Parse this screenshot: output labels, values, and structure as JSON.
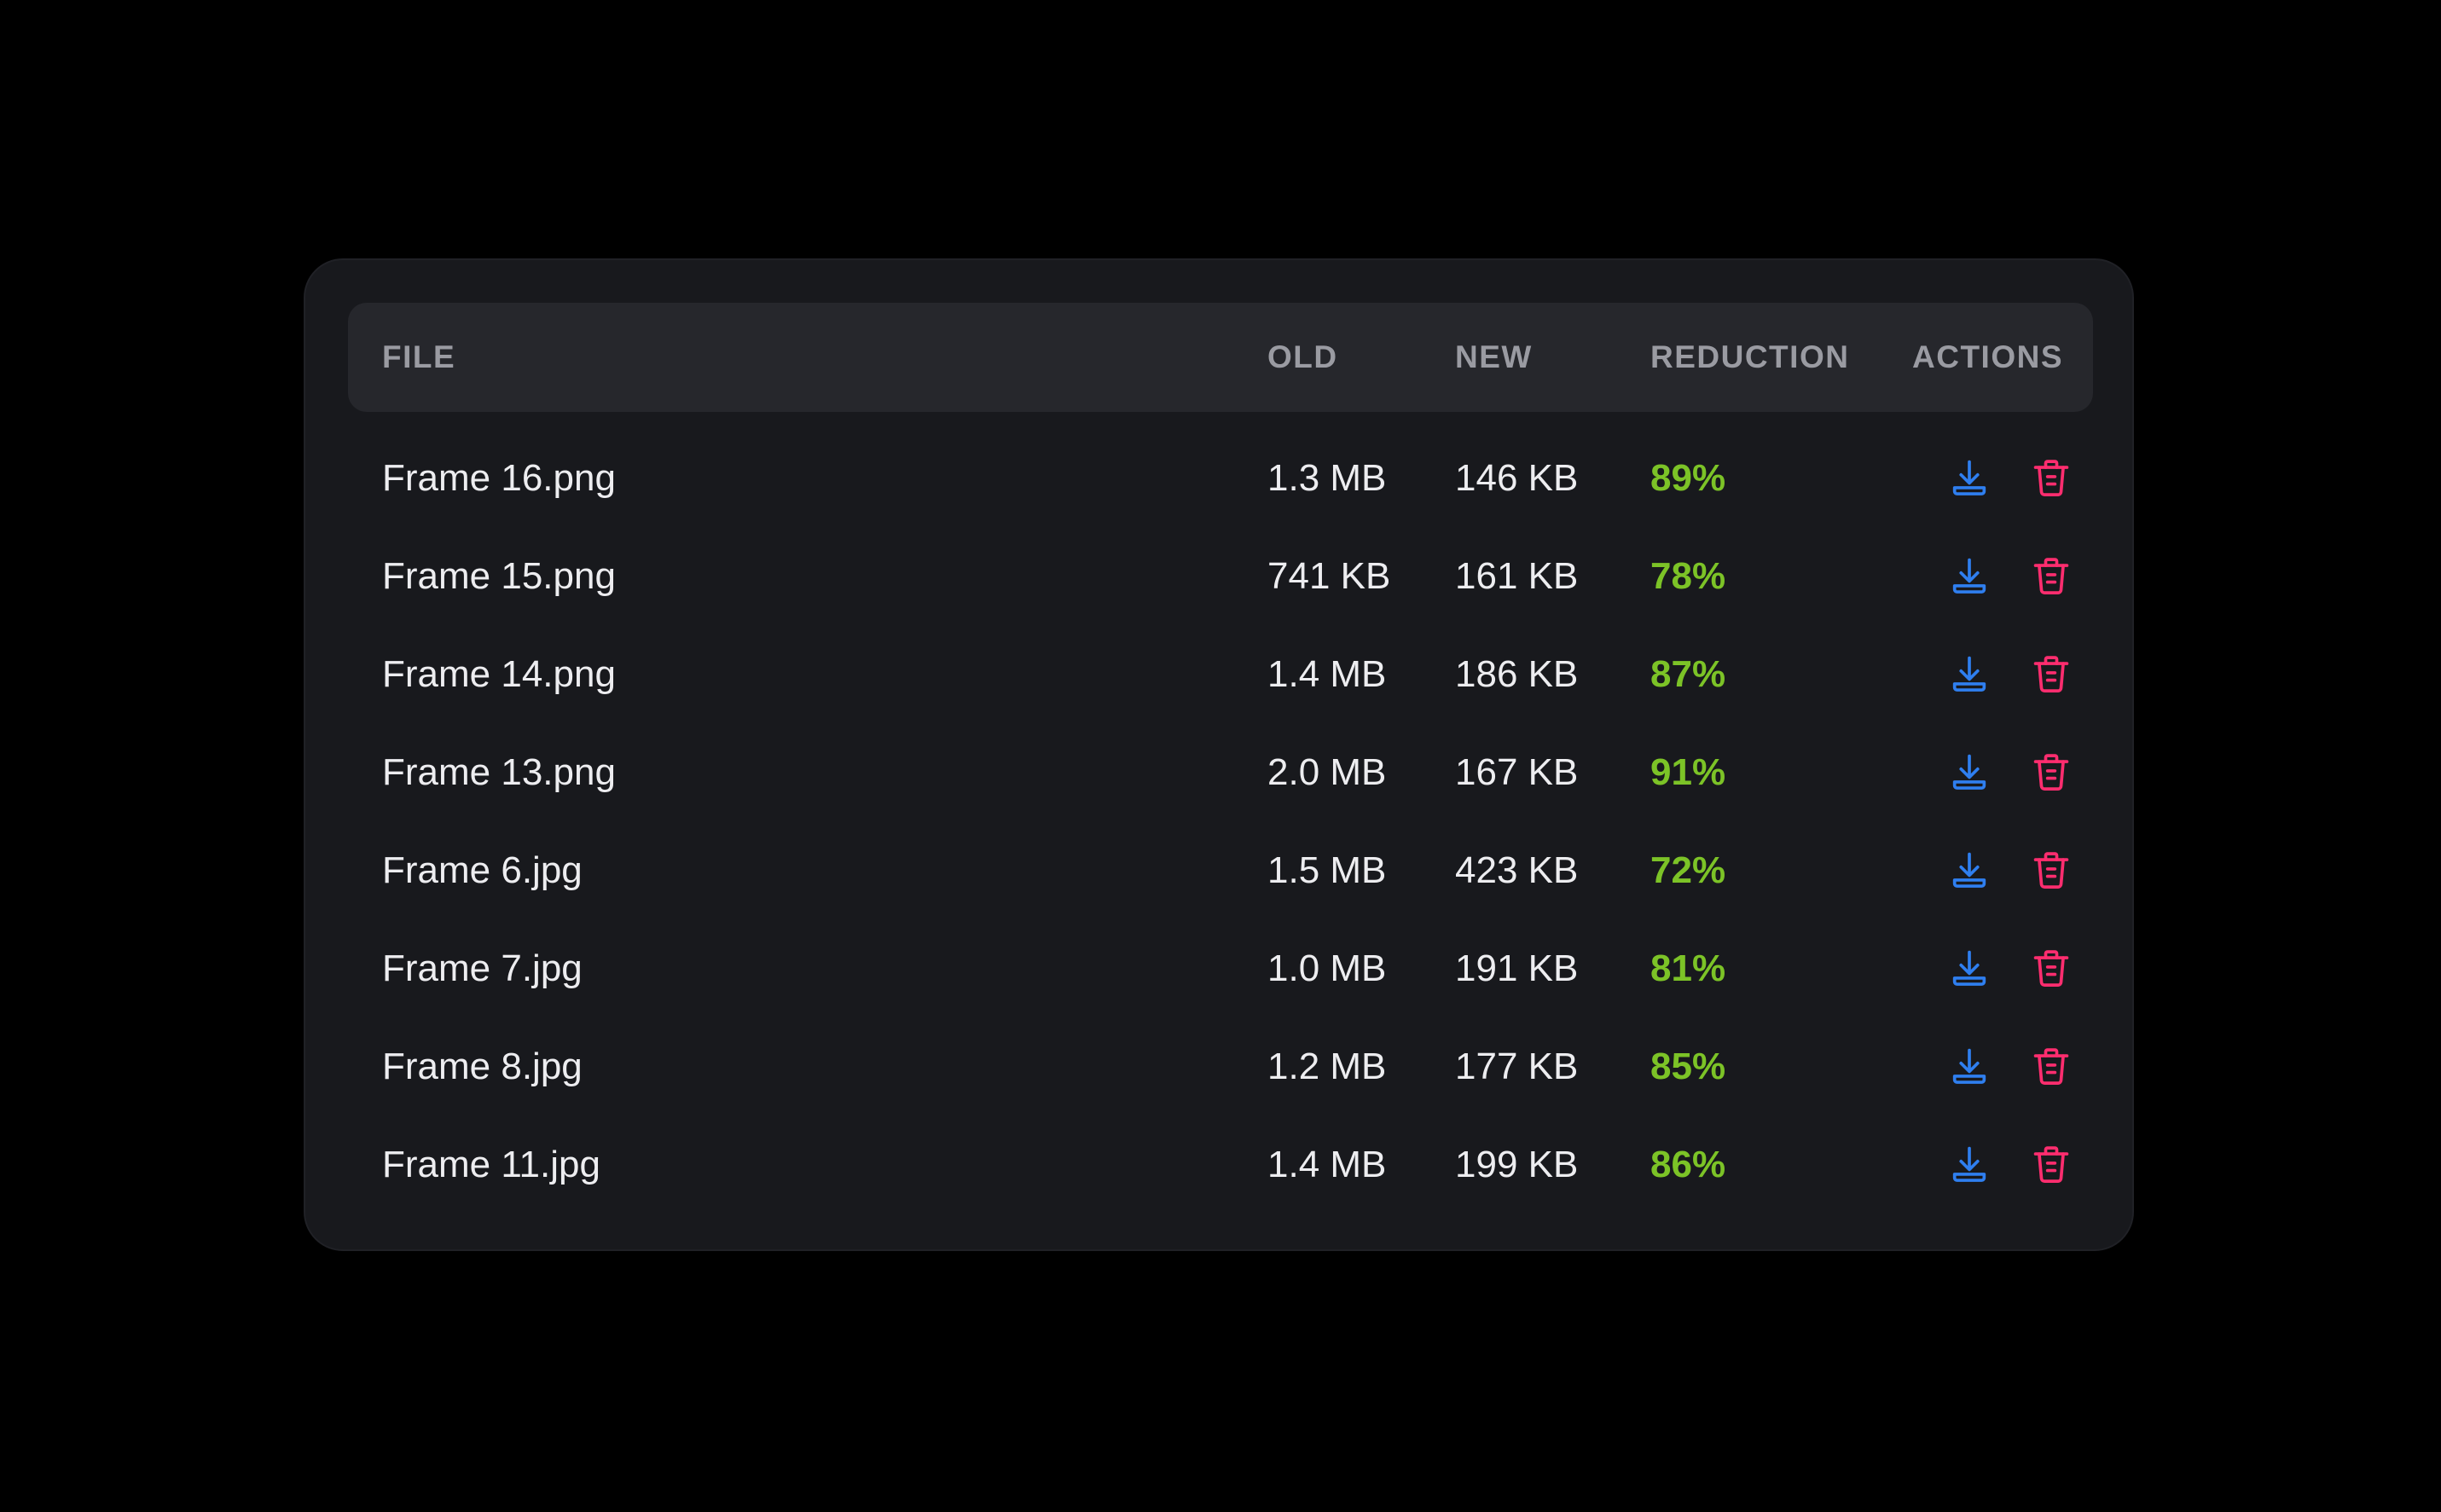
{
  "table": {
    "columns": {
      "file": "FILE",
      "old": "OLD",
      "new": "NEW",
      "reduction": "REDUCTION",
      "actions": "ACTIONS"
    },
    "rows": [
      {
        "file": "Frame 16.png",
        "old": "1.3 MB",
        "new": "146 KB",
        "reduction": "89%"
      },
      {
        "file": "Frame 15.png",
        "old": "741 KB",
        "new": "161 KB",
        "reduction": "78%"
      },
      {
        "file": "Frame 14.png",
        "old": "1.4 MB",
        "new": "186 KB",
        "reduction": "87%"
      },
      {
        "file": "Frame 13.png",
        "old": "2.0 MB",
        "new": "167 KB",
        "reduction": "91%"
      },
      {
        "file": "Frame 6.jpg",
        "old": "1.5 MB",
        "new": "423 KB",
        "reduction": "72%"
      },
      {
        "file": "Frame 7.jpg",
        "old": "1.0 MB",
        "new": "191 KB",
        "reduction": "81%"
      },
      {
        "file": "Frame 8.jpg",
        "old": "1.2 MB",
        "new": "177 KB",
        "reduction": "85%"
      },
      {
        "file": "Frame 11.jpg",
        "old": "1.4 MB",
        "new": "199 KB",
        "reduction": "86%"
      }
    ],
    "row_actions": [
      "download-icon",
      "trash-icon"
    ]
  },
  "colors": {
    "background": "#000000",
    "card": "#18191d",
    "header": "#26272c",
    "header_text": "#9a9ba2",
    "text": "#ededf0",
    "reduction": "#7cc327",
    "download": "#2f7ff0",
    "delete": "#ff2d6f"
  }
}
